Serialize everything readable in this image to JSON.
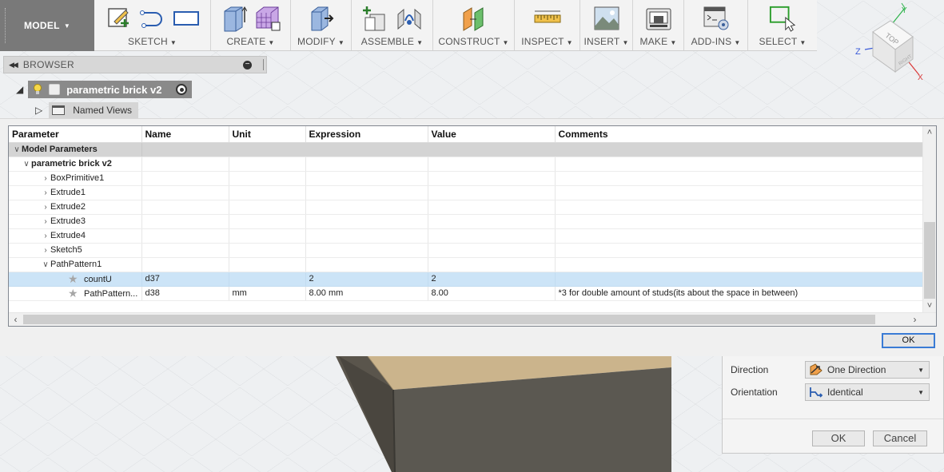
{
  "toolbar": {
    "workspace": "MODEL",
    "groups": [
      {
        "label": "SKETCH"
      },
      {
        "label": "CREATE"
      },
      {
        "label": "MODIFY"
      },
      {
        "label": "ASSEMBLE"
      },
      {
        "label": "CONSTRUCT"
      },
      {
        "label": "INSPECT"
      },
      {
        "label": "INSERT"
      },
      {
        "label": "MAKE"
      },
      {
        "label": "ADD-INS"
      },
      {
        "label": "SELECT"
      }
    ]
  },
  "browser": {
    "title": "BROWSER",
    "root": "parametric brick v2",
    "named_views": "Named Views"
  },
  "viewcube": {
    "face": "TOP",
    "side": "RIGHT",
    "axes": {
      "x": "X",
      "y": "Y",
      "z": "Z"
    }
  },
  "parameters": {
    "columns": [
      "Parameter",
      "Name",
      "Unit",
      "Expression",
      "Value",
      "Comments"
    ],
    "group": "Model Parameters",
    "component": "parametric brick v2",
    "features": [
      "BoxPrimitive1",
      "Extrude1",
      "Extrude2",
      "Extrude3",
      "Extrude4",
      "Sketch5",
      "PathPattern1"
    ],
    "rows": [
      {
        "parameter": "countU",
        "name": "d37",
        "unit": "",
        "expression": "2",
        "value": "2",
        "comments": ""
      },
      {
        "parameter": "PathPattern...",
        "name": "d38",
        "unit": "mm",
        "expression": "8.00 mm",
        "value": "8.00",
        "comments": "*3 for double amount of studs(its about the space in between)"
      }
    ],
    "ok_label": "OK"
  },
  "pattern_panel": {
    "direction_label": "Direction",
    "direction_value": "One Direction",
    "orientation_label": "Orientation",
    "orientation_value": "Identical",
    "ok_label": "OK",
    "cancel_label": "Cancel"
  },
  "colors": {
    "accent": "#3a7bd5",
    "selected_row": "#cce4f7",
    "group_row": "#d4d4d4",
    "workspace_button": "#797979"
  }
}
